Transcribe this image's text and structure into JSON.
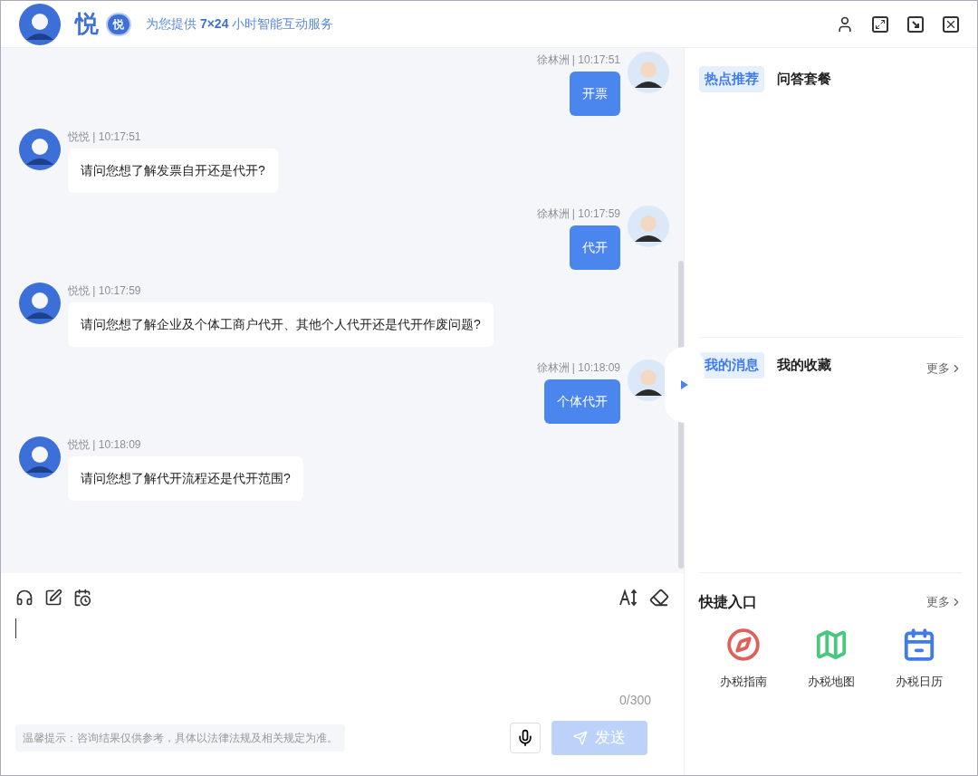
{
  "header": {
    "brand": "悦",
    "badge": "悦",
    "tagline_prefix": "为您提供",
    "tagline_highlight": "7×24",
    "tagline_suffix": "小时智能互动服务"
  },
  "messages": [
    {
      "kind": "user",
      "meta": "徐林洲 | 10:17:51",
      "text": "开票"
    },
    {
      "kind": "bot",
      "meta": "悦悦 | 10:17:51",
      "text": "请问您想了解发票自开还是代开?"
    },
    {
      "kind": "user",
      "meta": "徐林洲 | 10:17:59",
      "text": "代开"
    },
    {
      "kind": "bot",
      "meta": "悦悦 | 10:17:59",
      "text": "请问您想了解企业及个体工商户代开、其他个人代开还是代开作废问题?"
    },
    {
      "kind": "user",
      "meta": "徐林洲 | 10:18:09",
      "text": "个体代开"
    },
    {
      "kind": "bot",
      "meta": "悦悦 | 10:18:09",
      "text": "请问您想了解代开流程还是代开范围?"
    }
  ],
  "composer": {
    "counter": "0/300",
    "tip": "温馨提示：咨询结果仅供参考，具体以法律法规及相关规定为准。",
    "send": "发送",
    "send_disabled": true
  },
  "hot_tabs": [
    {
      "label": "热点推荐",
      "selected": true
    },
    {
      "label": "问答套餐",
      "selected": false
    }
  ],
  "message_tabs": [
    {
      "label": "我的消息",
      "selected": true
    },
    {
      "label": "我的收藏",
      "selected": false
    }
  ],
  "message_more": "更多",
  "shortcuts": {
    "title": "快捷入口",
    "more": "更多",
    "items": [
      {
        "kind": "compass",
        "label": "办税指南",
        "color": "#e0605a"
      },
      {
        "kind": "map",
        "label": "办税地图",
        "color": "#4ac77e"
      },
      {
        "kind": "calendar",
        "label": "办税日历",
        "color": "#3f7bea"
      }
    ]
  }
}
